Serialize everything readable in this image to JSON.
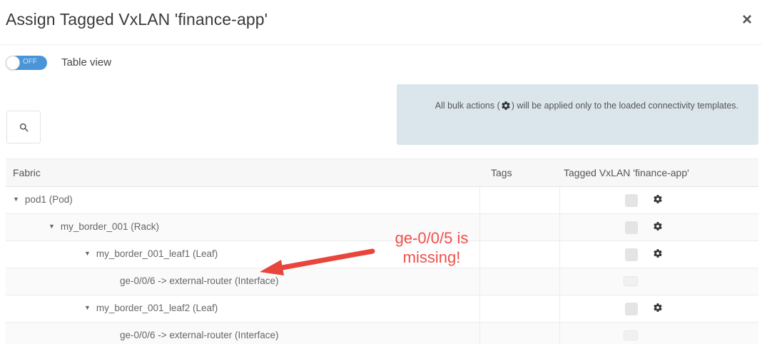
{
  "dialog": {
    "title": "Assign Tagged VxLAN 'finance-app'",
    "close_glyph": "×"
  },
  "toggle": {
    "state_label": "OFF",
    "label": "Table view",
    "is_on": false
  },
  "info": {
    "text_before": "All bulk actions (",
    "text_after": ") will be applied only to the loaded connectivity templates.",
    "icon": "gear-icon"
  },
  "search": {
    "icon": "search-icon"
  },
  "table": {
    "columns": [
      "Fabric",
      "Tags",
      "Tagged VxLAN 'finance-app'"
    ],
    "rows": [
      {
        "label": "pod1 (Pod)",
        "expanded": true,
        "level": 1,
        "has_gear": true
      },
      {
        "label": "my_border_001 (Rack)",
        "expanded": true,
        "level": 2,
        "has_gear": true
      },
      {
        "label": "my_border_001_leaf1 (Leaf)",
        "expanded": true,
        "level": 3,
        "has_gear": true
      },
      {
        "label": "ge-0/0/6 -> external-router (Interface)",
        "expanded": null,
        "level": 4,
        "has_gear": false
      },
      {
        "label": "my_border_001_leaf2 (Leaf)",
        "expanded": true,
        "level": 3,
        "has_gear": true
      },
      {
        "label": "ge-0/0/6 -> external-router (Interface)",
        "expanded": null,
        "level": 4,
        "has_gear": false
      }
    ]
  },
  "annotation": {
    "line1": "ge-0/0/5 is",
    "line2": "missing!",
    "color": "#f0504a"
  },
  "colors": {
    "toggle_off": "#4a95d8",
    "info_bg": "#dbe6ec"
  }
}
